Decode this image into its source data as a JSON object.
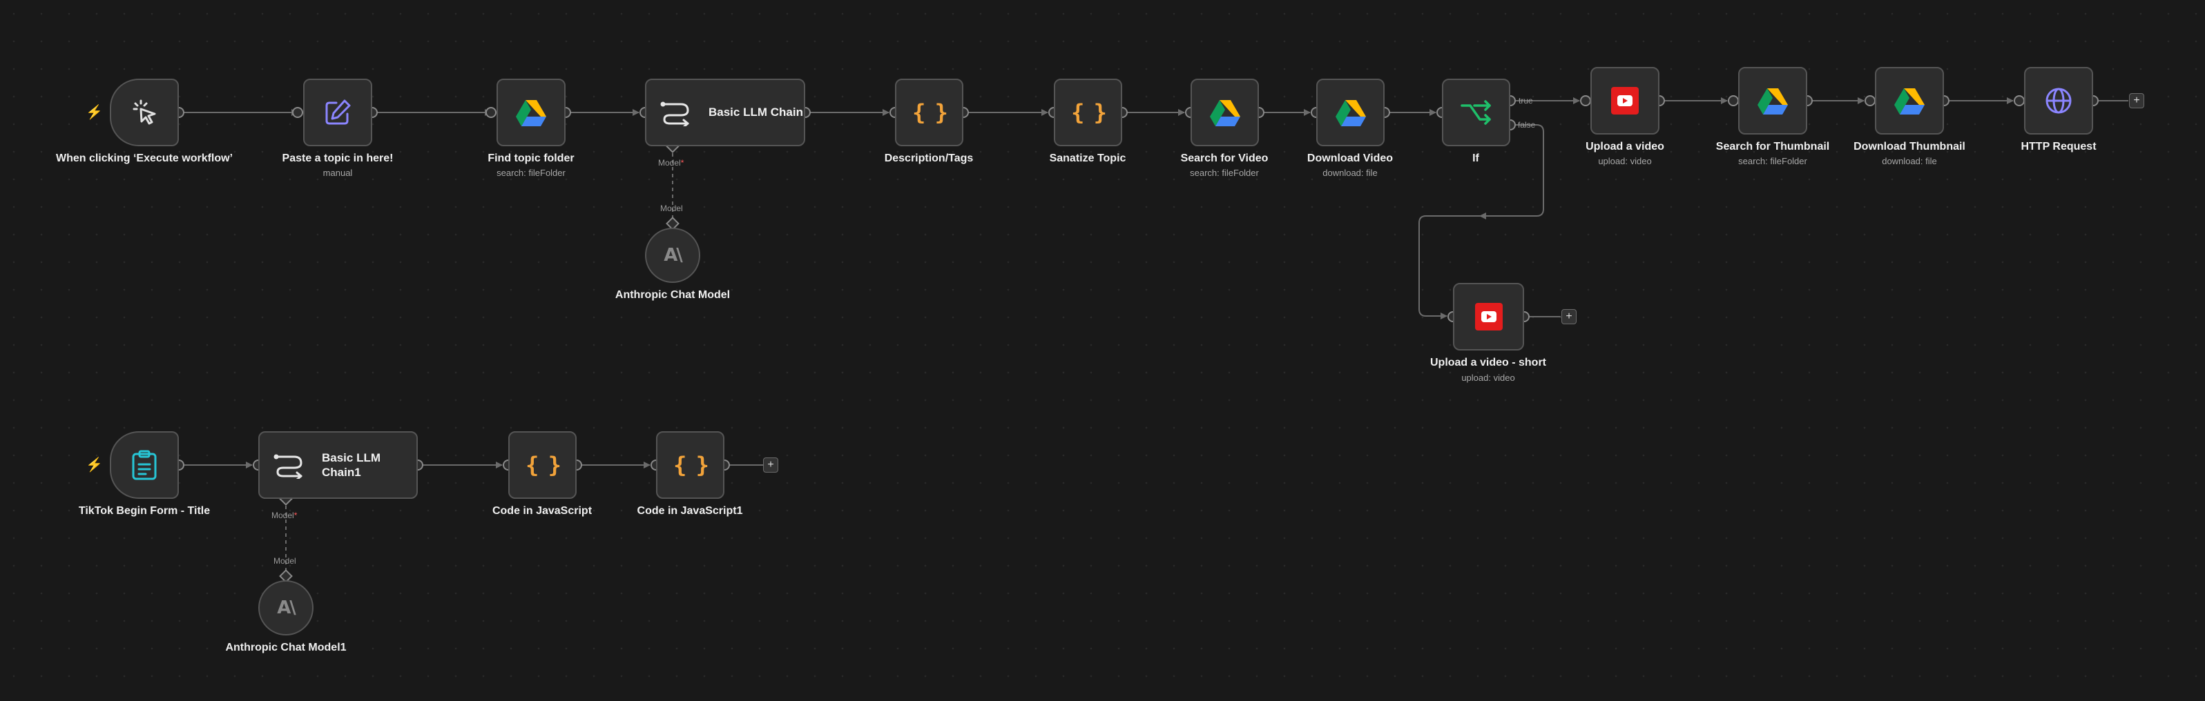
{
  "canvas": {
    "theme": {
      "background": "#191919",
      "node_fill": "#2d2d2d",
      "node_border": "#555555",
      "connector": "#6b6b6b",
      "trigger_accent": "#ff6d2e"
    }
  },
  "nodes": [
    {
      "id": "execute-trigger",
      "title": "When clicking ‘Execute workflow’",
      "subtitle": "",
      "icon": "cursor-click-icon"
    },
    {
      "id": "paste-topic",
      "title": "Paste a topic in here!",
      "subtitle": "manual",
      "icon": "pencil-edit-icon"
    },
    {
      "id": "find-topic-folder",
      "title": "Find topic folder",
      "subtitle": "search: fileFolder",
      "icon": "google-drive-icon"
    },
    {
      "id": "basic-llm-chain",
      "title": "Basic LLM Chain",
      "subtitle": "",
      "icon": "llm-chain-icon"
    },
    {
      "id": "anthropic-chat-model",
      "title": "Anthropic Chat Model",
      "subtitle": "",
      "icon": "anthropic-icon"
    },
    {
      "id": "description-tags",
      "title": "Description/Tags",
      "subtitle": "",
      "icon": "code-braces-icon"
    },
    {
      "id": "sanatize-topic",
      "title": "Sanatize Topic",
      "subtitle": "",
      "icon": "code-braces-icon"
    },
    {
      "id": "search-for-video",
      "title": "Search for Video",
      "subtitle": "search: fileFolder",
      "icon": "google-drive-icon"
    },
    {
      "id": "download-video",
      "title": "Download Video",
      "subtitle": "download: file",
      "icon": "google-drive-icon"
    },
    {
      "id": "if",
      "title": "If",
      "subtitle": "",
      "icon": "branch-icon"
    },
    {
      "id": "upload-a-video",
      "title": "Upload a video",
      "subtitle": "upload: video",
      "icon": "youtube-icon"
    },
    {
      "id": "search-for-thumbnail",
      "title": "Search for Thumbnail",
      "subtitle": "search: fileFolder",
      "icon": "google-drive-icon"
    },
    {
      "id": "download-thumbnail",
      "title": "Download Thumbnail",
      "subtitle": "download: file",
      "icon": "google-drive-icon"
    },
    {
      "id": "http-request",
      "title": "HTTP Request",
      "subtitle": "",
      "icon": "globe-icon"
    },
    {
      "id": "upload-video-short",
      "title": "Upload a video - short",
      "subtitle": "upload: video",
      "icon": "youtube-icon"
    },
    {
      "id": "tiktok-form",
      "title": "TikTok Begin Form - Title",
      "subtitle": "",
      "icon": "clipboard-icon"
    },
    {
      "id": "basic-llm-chain-1",
      "title": "Basic LLM Chain1",
      "subtitle": "",
      "icon": "llm-chain-icon"
    },
    {
      "id": "anthropic-chat-model-1",
      "title": "Anthropic Chat Model1",
      "subtitle": "",
      "icon": "anthropic-icon"
    },
    {
      "id": "code-in-javascript",
      "title": "Code in JavaScript",
      "subtitle": "",
      "icon": "code-braces-icon"
    },
    {
      "id": "code-in-javascript-1",
      "title": "Code in JavaScript1",
      "subtitle": "",
      "icon": "code-braces-icon"
    }
  ],
  "ports": {
    "model_required": "Model",
    "model_input": "Model",
    "required_mark": "*"
  },
  "branches": {
    "true_label": "true",
    "false_label": "false"
  },
  "add_button": "+"
}
